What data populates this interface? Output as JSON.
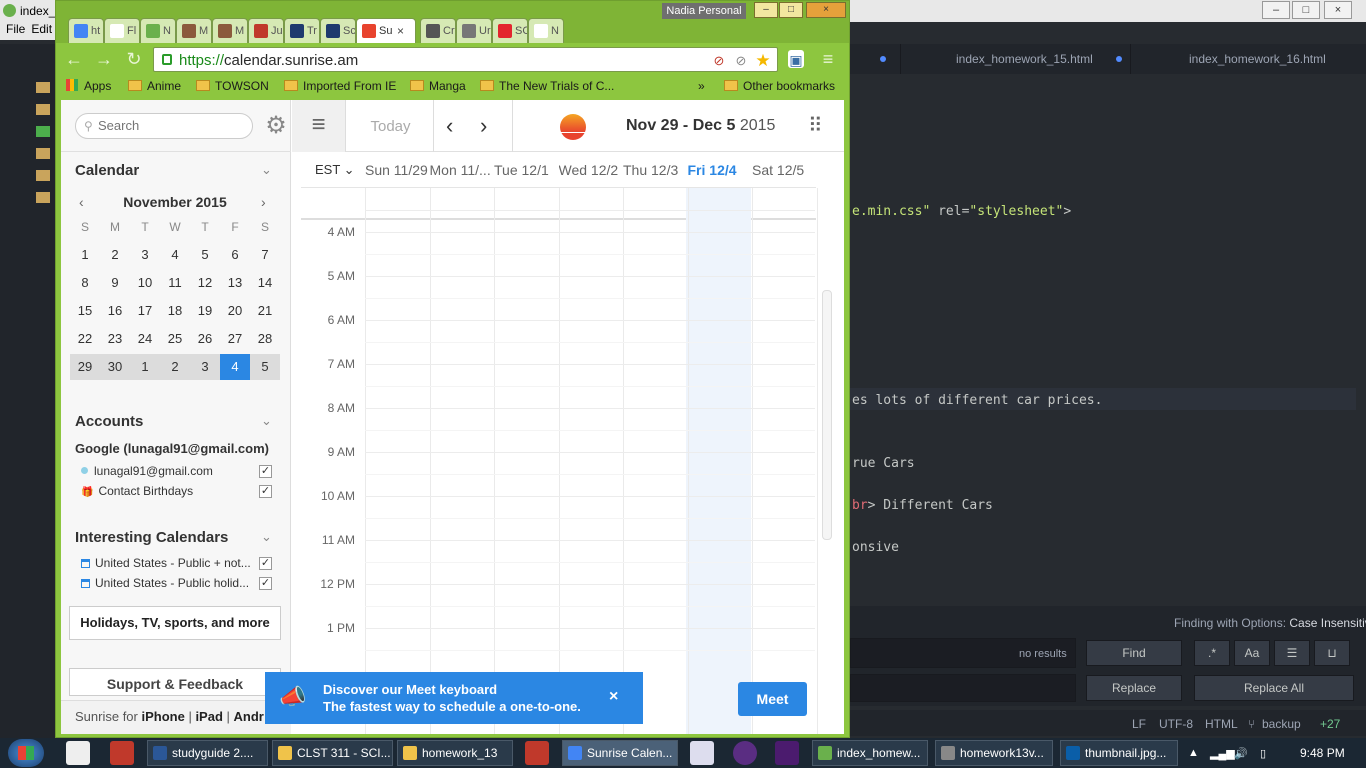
{
  "editor": {
    "window_title": "index_",
    "menu": [
      "File",
      "Edit"
    ],
    "tabs": [
      "index_homework_15.html",
      "index_homework_16.html"
    ],
    "code_lines": [
      {
        "parts": [
          {
            "t": "e.min.css\"",
            "c": "str"
          },
          {
            "t": " rel=",
            "c": ""
          },
          {
            "t": "\"stylesheet\"",
            "c": "str"
          },
          {
            "t": ">",
            "c": ""
          }
        ]
      },
      {
        "parts": [
          {
            "t": "es lots of different car prices.",
            "c": ""
          }
        ]
      },
      {
        "parts": [
          {
            "t": "rue Cars",
            "c": ""
          }
        ]
      },
      {
        "parts": [
          {
            "t": "br",
            "c": "red"
          },
          {
            "t": "> Different Cars",
            "c": ""
          }
        ]
      },
      {
        "parts": [
          {
            "t": "onsive",
            "c": ""
          }
        ]
      }
    ],
    "find": {
      "label_prefix": "Finding with Options: ",
      "label_option": "Case Insensitive",
      "no_results": "no results",
      "find_label": "Find",
      "replace_label": "Replace",
      "replace_all_label": "Replace All",
      "regex_label": ".*",
      "case_label": "Aa"
    },
    "status": {
      "lf": "LF",
      "encoding": "UTF-8",
      "grammar": "HTML",
      "branch": "backup",
      "diff": "+27"
    }
  },
  "browser": {
    "tabs": [
      {
        "label": "ht",
        "color": "#4285f4"
      },
      {
        "label": "Fl",
        "color": "#ffffff"
      },
      {
        "label": "N",
        "color": "#6ab04c"
      },
      {
        "label": "M",
        "color": "#8b5a3c"
      },
      {
        "label": "M",
        "color": "#8b5a3c"
      },
      {
        "label": "Ju",
        "color": "#c0392b"
      },
      {
        "label": "Tr",
        "color": "#1e3a6e"
      },
      {
        "label": "Sc",
        "color": "#1e3a6e"
      },
      {
        "label": "Su",
        "color": "#e8432e"
      },
      {
        "label": "Cr",
        "color": "#555555"
      },
      {
        "label": "Ur",
        "color": "#777777"
      },
      {
        "label": "SC",
        "color": "#e3262e"
      },
      {
        "label": "N",
        "color": "#ffffff"
      }
    ],
    "active_tab_index": 8,
    "profile": "Nadia Personal",
    "url_scheme": "https://",
    "url_host": "calendar.sunrise.am",
    "bookmarks": [
      "Apps",
      "Anime",
      "TOWSON",
      "Imported From IE",
      "Manga",
      "The New Trials of C...",
      "»",
      "Other bookmarks"
    ]
  },
  "sidebar": {
    "search_placeholder": "Search",
    "calendar_header": "Calendar",
    "mini_cal": {
      "month": "November 2015",
      "dow": [
        "S",
        "M",
        "T",
        "W",
        "T",
        "F",
        "S"
      ],
      "weeks": [
        [
          "1",
          "2",
          "3",
          "4",
          "5",
          "6",
          "7"
        ],
        [
          "8",
          "9",
          "10",
          "11",
          "12",
          "13",
          "14"
        ],
        [
          "15",
          "16",
          "17",
          "18",
          "19",
          "20",
          "21"
        ],
        [
          "22",
          "23",
          "24",
          "25",
          "26",
          "27",
          "28"
        ],
        [
          "29",
          "30",
          "1",
          "2",
          "3",
          "4",
          "5"
        ]
      ],
      "selected_week_index": 4,
      "today_day_index": 5
    },
    "accounts_header": "Accounts",
    "account_name": "Google (lunagal91@gmail.com)",
    "account_items": [
      "lunagal91@gmail.com",
      "Contact Birthdays"
    ],
    "interesting_header": "Interesting Calendars",
    "interesting_items": [
      "United States - Public + not...",
      "United States - Public holid..."
    ],
    "holidays_button": "Holidays, TV, sports, and more",
    "support_button": "Support & Feedback",
    "footer_prefix": "Sunrise for ",
    "footer_iphone": "iPhone",
    "footer_ipad": "iPad",
    "footer_android": "Andr"
  },
  "main": {
    "today": "Today",
    "range_bold": "Nov 29 - Dec 5",
    "range_year": "2015",
    "timezone": "EST",
    "days": [
      "Sun 11/29",
      "Mon 11/...",
      "Tue 12/1",
      "Wed 12/2",
      "Thu 12/3",
      "Fri 12/4",
      "Sat 12/5"
    ],
    "active_day_index": 5,
    "hours": [
      "4 AM",
      "5 AM",
      "6 AM",
      "7 AM",
      "8 AM",
      "9 AM",
      "10 AM",
      "11 AM",
      "12 PM",
      "1 PM"
    ]
  },
  "banner": {
    "title": "Discover our Meet keyboard",
    "subtitle": "The fastest way to schedule a one-to-one.",
    "close": "×",
    "meet_label": "Meet"
  },
  "taskbar": {
    "items": [
      {
        "label": "studyguide 2....",
        "color": "#2b5797"
      },
      {
        "label": "CLST 311 - SCI...",
        "color": "#f0c34a"
      },
      {
        "label": "homework_13",
        "color": "#f0c34a"
      },
      {
        "label": "Sunrise Calen...",
        "color": "#4285f4"
      },
      {
        "label": "index_homew...",
        "color": "#6ab04c"
      },
      {
        "label": "homework13v...",
        "color": "#888888"
      },
      {
        "label": "thumbnail.jpg...",
        "color": "#0a5ea8"
      }
    ],
    "active_index": 3,
    "clock": "9:48 PM"
  }
}
